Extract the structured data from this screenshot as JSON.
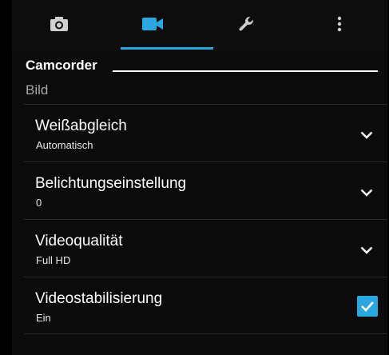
{
  "tabs": [
    {
      "icon": "camera-icon",
      "selected": false
    },
    {
      "icon": "video-camera-icon",
      "selected": true
    },
    {
      "icon": "wrench-icon",
      "selected": false
    },
    {
      "icon": "more-vertical-icon",
      "selected": false
    }
  ],
  "page": {
    "title": "Camcorder",
    "section": "Bild"
  },
  "settings": [
    {
      "title": "Weißabgleich",
      "value": "Automatisch",
      "control": "chevron-down-icon"
    },
    {
      "title": "Belichtungseinstellung",
      "value": "0",
      "control": "chevron-down-icon"
    },
    {
      "title": "Videoqualität",
      "value": "Full HD",
      "control": "chevron-down-icon"
    },
    {
      "title": "Videostabilisierung",
      "value": "Ein",
      "control": "checkbox",
      "checked": true
    }
  ],
  "colors": {
    "accent": "#2aa7e0",
    "background": "#0b0b0b",
    "section_text": "#a8a8a8"
  }
}
